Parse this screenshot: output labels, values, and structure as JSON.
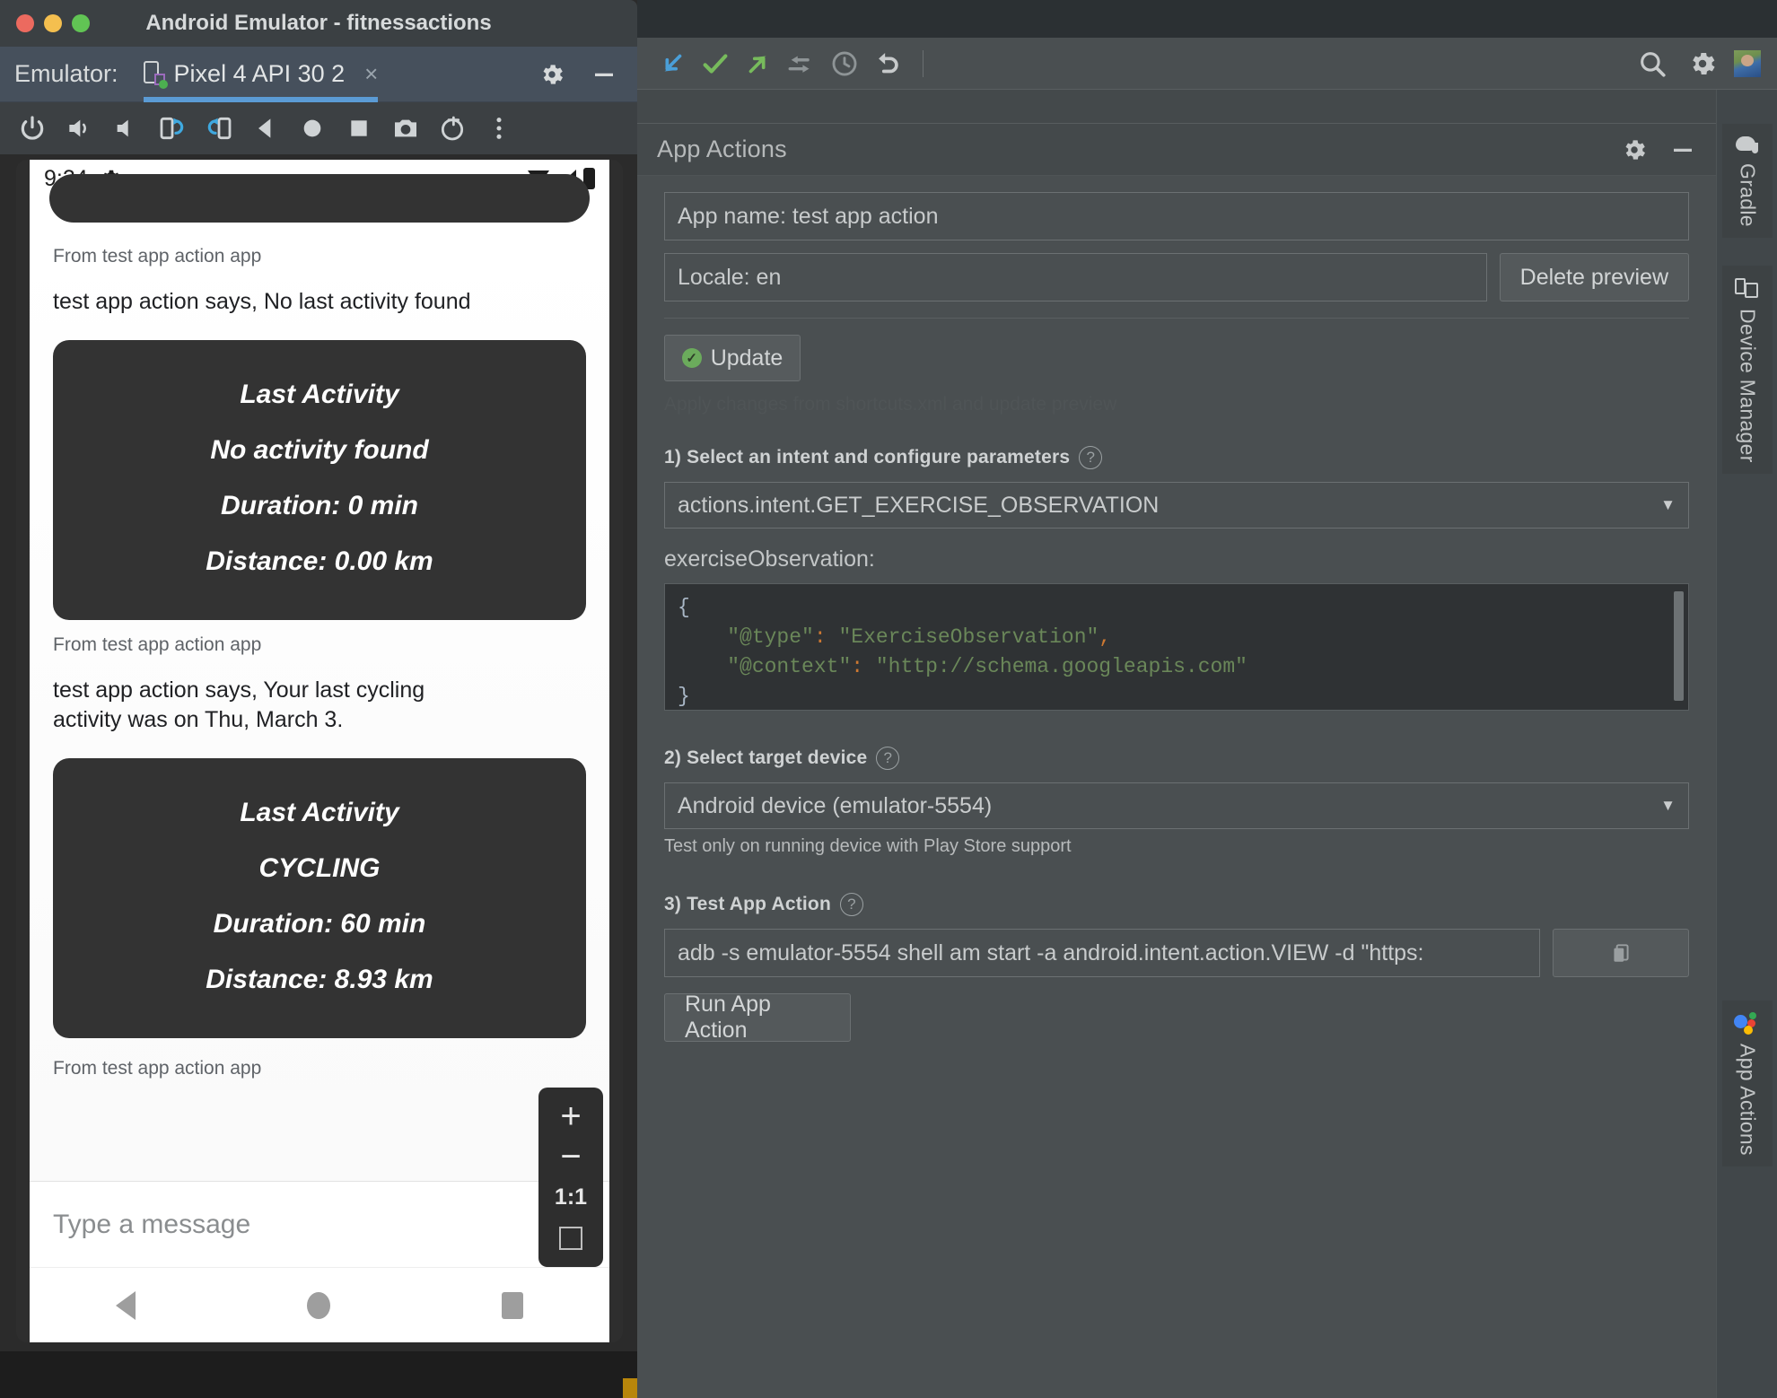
{
  "emulator": {
    "window_title": "Android Emulator - fitnessactions",
    "traffic_lights": [
      "close",
      "minimize",
      "zoom"
    ],
    "tabbar": {
      "label": "Emulator:",
      "tab_name": "Pixel 4 API 30 2",
      "close_glyph": "×",
      "gear_icon": "gear-icon",
      "minimize_glyph": "—"
    },
    "controls": [
      "power-icon",
      "volume-up-icon",
      "volume-down-icon",
      "rotate-left-icon",
      "rotate-right-icon",
      "back-icon",
      "home-icon",
      "overview-icon",
      "screenshot-icon",
      "record-icon",
      "more-icon"
    ],
    "phone": {
      "status": {
        "time": "9:24",
        "gear_icon": "gear-icon",
        "wifi_icon": "wifi-icon",
        "signal_icon": "signal-icon",
        "battery_icon": "battery-icon"
      },
      "messages": [
        {
          "from": "From test app action app",
          "says": "test app action says, No last activity found",
          "card": {
            "title": "Last Activity",
            "activity": "No activity found",
            "duration": "Duration: 0 min",
            "distance": "Distance: 0.00 km"
          }
        },
        {
          "from": "From test app action app",
          "says": "test app action says, Your last cycling activity was on Thu, March 3.",
          "card": {
            "title": "Last Activity",
            "activity": "CYCLING",
            "duration": "Duration: 60 min",
            "distance": "Distance: 8.93 km"
          }
        },
        {
          "from": "From test app action app",
          "says": "",
          "card": null
        }
      ],
      "input_placeholder": "Type a message",
      "nav": [
        "back-button",
        "home-button",
        "recents-button"
      ]
    },
    "zoom_controls": {
      "zoom_in": "+",
      "zoom_out": "−",
      "actual_size": "1:1",
      "fit_screen": "expand-icon"
    }
  },
  "ide": {
    "toolbar_icons": [
      "pull-arrow-icon",
      "commit-check-icon",
      "push-arrow-icon",
      "rebase-icon",
      "history-clock-icon",
      "revert-undo-icon"
    ],
    "toolbar_right_icons": [
      "search-icon",
      "gear-icon",
      "avatar"
    ],
    "panel": {
      "title": "App Actions",
      "header_icons": [
        "gear-icon",
        "minimize-icon"
      ],
      "app_name_field": "App name: test app action",
      "locale_field": "Locale: en",
      "delete_preview_button": "Delete preview",
      "update_button": "Update",
      "update_hint": "Apply changes from shortcuts.xml and update preview",
      "step1": {
        "label": "1) Select an intent and configure parameters",
        "help_icon": "help-icon",
        "intent_selected": "actions.intent.GET_EXERCISE_OBSERVATION",
        "param_label": "exerciseObservation:",
        "code": {
          "line1": "{",
          "line2_key": "\"@type\"",
          "line2_colon": ":",
          "line2_val": " \"ExerciseObservation\"",
          "line2_comma": ",",
          "line3_key": "\"@context\"",
          "line3_colon": ":",
          "line3_val": " \"http://schema.googleapis.com\"",
          "line4": "}"
        }
      },
      "step2": {
        "label": "2) Select target device",
        "help_icon": "help-icon",
        "device_selected": "Android device (emulator-5554)",
        "note": "Test only on running device with Play Store support"
      },
      "step3": {
        "label": "3) Test App Action",
        "help_icon": "help-icon",
        "adb_command": "adb -s emulator-5554 shell am start -a android.intent.action.VIEW -d \"https:",
        "copy_icon": "copy-icon",
        "run_button": "Run App Action"
      }
    },
    "right_rail": [
      {
        "label": "Gradle",
        "icon": "gradle-elephant-icon"
      },
      {
        "label": "Device Manager",
        "icon": "device-manager-icon"
      },
      {
        "label": "App Actions",
        "icon": "google-dots-icon"
      }
    ]
  },
  "colors": {
    "ide_bg": "#4a4f51",
    "panel_header_bg": "#44494b",
    "accent_blue": "#5b9bd5",
    "accent_green": "#6bab5c",
    "code_bg": "#2f3234",
    "card_bg": "#333333"
  }
}
